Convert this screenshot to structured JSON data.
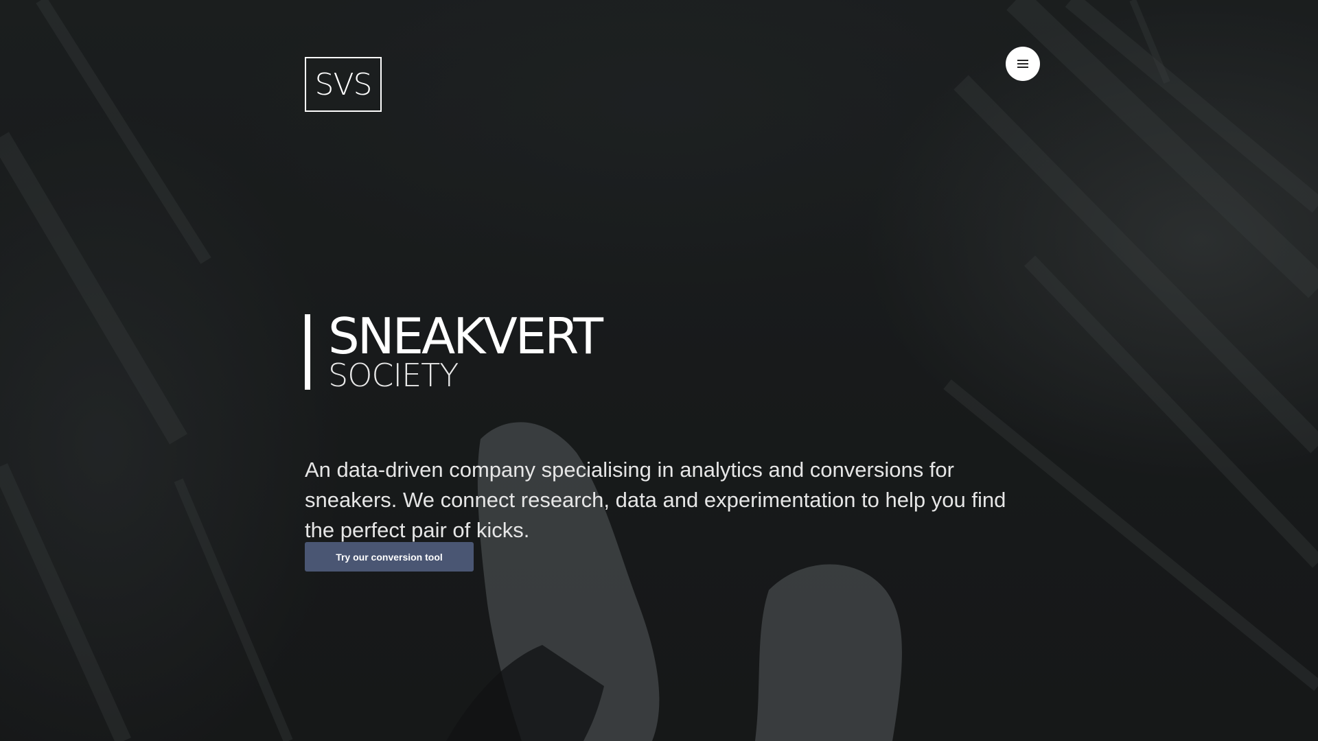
{
  "logo": {
    "text": "SVS"
  },
  "menu": {
    "icon": "hamburger-menu-icon"
  },
  "hero": {
    "title": "SNEAKVERT",
    "subtitle": "SOCIETY",
    "description": "An data-driven company specialising in analytics and conversions for sneakers. We connect research, data and experimentation to help you find the perfect pair of kicks.",
    "cta_label": "Try our conversion tool"
  },
  "colors": {
    "background": "#1b1d1e",
    "cta_background": "#4a5673",
    "text": "#ffffff"
  }
}
